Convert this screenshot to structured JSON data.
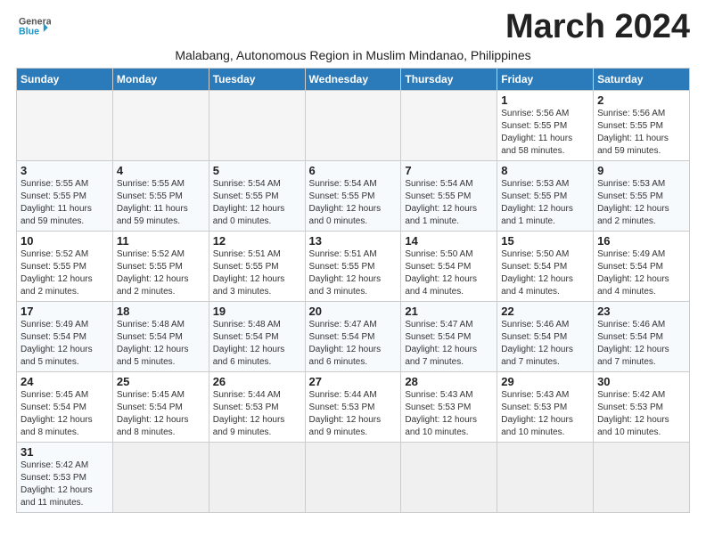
{
  "header": {
    "logo_line1": "General",
    "logo_line2": "Blue",
    "month_title": "March 2024",
    "subtitle": "Malabang, Autonomous Region in Muslim Mindanao, Philippines"
  },
  "days_of_week": [
    "Sunday",
    "Monday",
    "Tuesday",
    "Wednesday",
    "Thursday",
    "Friday",
    "Saturday"
  ],
  "weeks": [
    [
      {
        "day": "",
        "info": ""
      },
      {
        "day": "",
        "info": ""
      },
      {
        "day": "",
        "info": ""
      },
      {
        "day": "",
        "info": ""
      },
      {
        "day": "",
        "info": ""
      },
      {
        "day": "1",
        "info": "Sunrise: 5:56 AM\nSunset: 5:55 PM\nDaylight: 11 hours\nand 58 minutes."
      },
      {
        "day": "2",
        "info": "Sunrise: 5:56 AM\nSunset: 5:55 PM\nDaylight: 11 hours\nand 59 minutes."
      }
    ],
    [
      {
        "day": "3",
        "info": "Sunrise: 5:55 AM\nSunset: 5:55 PM\nDaylight: 11 hours\nand 59 minutes."
      },
      {
        "day": "4",
        "info": "Sunrise: 5:55 AM\nSunset: 5:55 PM\nDaylight: 11 hours\nand 59 minutes."
      },
      {
        "day": "5",
        "info": "Sunrise: 5:54 AM\nSunset: 5:55 PM\nDaylight: 12 hours\nand 0 minutes."
      },
      {
        "day": "6",
        "info": "Sunrise: 5:54 AM\nSunset: 5:55 PM\nDaylight: 12 hours\nand 0 minutes."
      },
      {
        "day": "7",
        "info": "Sunrise: 5:54 AM\nSunset: 5:55 PM\nDaylight: 12 hours\nand 1 minute."
      },
      {
        "day": "8",
        "info": "Sunrise: 5:53 AM\nSunset: 5:55 PM\nDaylight: 12 hours\nand 1 minute."
      },
      {
        "day": "9",
        "info": "Sunrise: 5:53 AM\nSunset: 5:55 PM\nDaylight: 12 hours\nand 2 minutes."
      }
    ],
    [
      {
        "day": "10",
        "info": "Sunrise: 5:52 AM\nSunset: 5:55 PM\nDaylight: 12 hours\nand 2 minutes."
      },
      {
        "day": "11",
        "info": "Sunrise: 5:52 AM\nSunset: 5:55 PM\nDaylight: 12 hours\nand 2 minutes."
      },
      {
        "day": "12",
        "info": "Sunrise: 5:51 AM\nSunset: 5:55 PM\nDaylight: 12 hours\nand 3 minutes."
      },
      {
        "day": "13",
        "info": "Sunrise: 5:51 AM\nSunset: 5:55 PM\nDaylight: 12 hours\nand 3 minutes."
      },
      {
        "day": "14",
        "info": "Sunrise: 5:50 AM\nSunset: 5:54 PM\nDaylight: 12 hours\nand 4 minutes."
      },
      {
        "day": "15",
        "info": "Sunrise: 5:50 AM\nSunset: 5:54 PM\nDaylight: 12 hours\nand 4 minutes."
      },
      {
        "day": "16",
        "info": "Sunrise: 5:49 AM\nSunset: 5:54 PM\nDaylight: 12 hours\nand 4 minutes."
      }
    ],
    [
      {
        "day": "17",
        "info": "Sunrise: 5:49 AM\nSunset: 5:54 PM\nDaylight: 12 hours\nand 5 minutes."
      },
      {
        "day": "18",
        "info": "Sunrise: 5:48 AM\nSunset: 5:54 PM\nDaylight: 12 hours\nand 5 minutes."
      },
      {
        "day": "19",
        "info": "Sunrise: 5:48 AM\nSunset: 5:54 PM\nDaylight: 12 hours\nand 6 minutes."
      },
      {
        "day": "20",
        "info": "Sunrise: 5:47 AM\nSunset: 5:54 PM\nDaylight: 12 hours\nand 6 minutes."
      },
      {
        "day": "21",
        "info": "Sunrise: 5:47 AM\nSunset: 5:54 PM\nDaylight: 12 hours\nand 7 minutes."
      },
      {
        "day": "22",
        "info": "Sunrise: 5:46 AM\nSunset: 5:54 PM\nDaylight: 12 hours\nand 7 minutes."
      },
      {
        "day": "23",
        "info": "Sunrise: 5:46 AM\nSunset: 5:54 PM\nDaylight: 12 hours\nand 7 minutes."
      }
    ],
    [
      {
        "day": "24",
        "info": "Sunrise: 5:45 AM\nSunset: 5:54 PM\nDaylight: 12 hours\nand 8 minutes."
      },
      {
        "day": "25",
        "info": "Sunrise: 5:45 AM\nSunset: 5:54 PM\nDaylight: 12 hours\nand 8 minutes."
      },
      {
        "day": "26",
        "info": "Sunrise: 5:44 AM\nSunset: 5:53 PM\nDaylight: 12 hours\nand 9 minutes."
      },
      {
        "day": "27",
        "info": "Sunrise: 5:44 AM\nSunset: 5:53 PM\nDaylight: 12 hours\nand 9 minutes."
      },
      {
        "day": "28",
        "info": "Sunrise: 5:43 AM\nSunset: 5:53 PM\nDaylight: 12 hours\nand 10 minutes."
      },
      {
        "day": "29",
        "info": "Sunrise: 5:43 AM\nSunset: 5:53 PM\nDaylight: 12 hours\nand 10 minutes."
      },
      {
        "day": "30",
        "info": "Sunrise: 5:42 AM\nSunset: 5:53 PM\nDaylight: 12 hours\nand 10 minutes."
      }
    ],
    [
      {
        "day": "31",
        "info": "Sunrise: 5:42 AM\nSunset: 5:53 PM\nDaylight: 12 hours\nand 11 minutes."
      },
      {
        "day": "",
        "info": ""
      },
      {
        "day": "",
        "info": ""
      },
      {
        "day": "",
        "info": ""
      },
      {
        "day": "",
        "info": ""
      },
      {
        "day": "",
        "info": ""
      },
      {
        "day": "",
        "info": ""
      }
    ]
  ]
}
